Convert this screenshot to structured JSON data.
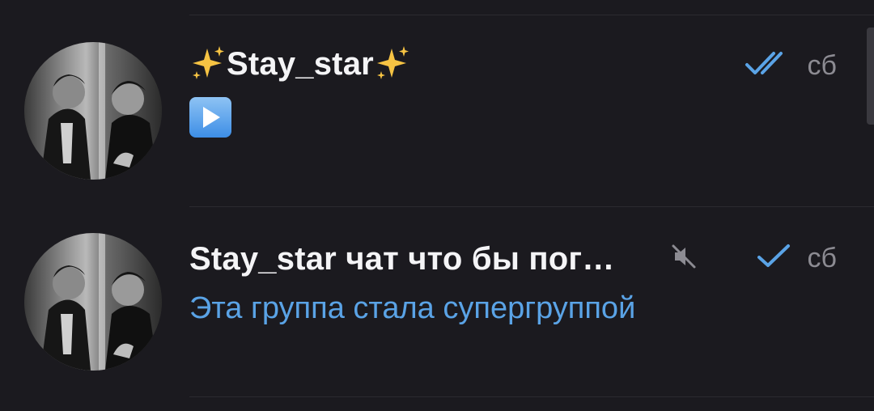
{
  "chats": [
    {
      "title": "Stay_star",
      "time": "сб",
      "status": "read",
      "title_emoji": "sparkles",
      "preview_icon": "play-button-emoji"
    },
    {
      "title": "Stay_star чат что бы пог…",
      "time": "сб",
      "status": "sent",
      "muted": true,
      "preview": "Эта группа стала супергруппой"
    }
  ],
  "colors": {
    "background": "#1b1a1f",
    "title": "#f4f4f6",
    "time": "#8c8b92",
    "accent": "#5aa3e6",
    "check": "#5aa3e6",
    "mute": "#8c8b92"
  }
}
